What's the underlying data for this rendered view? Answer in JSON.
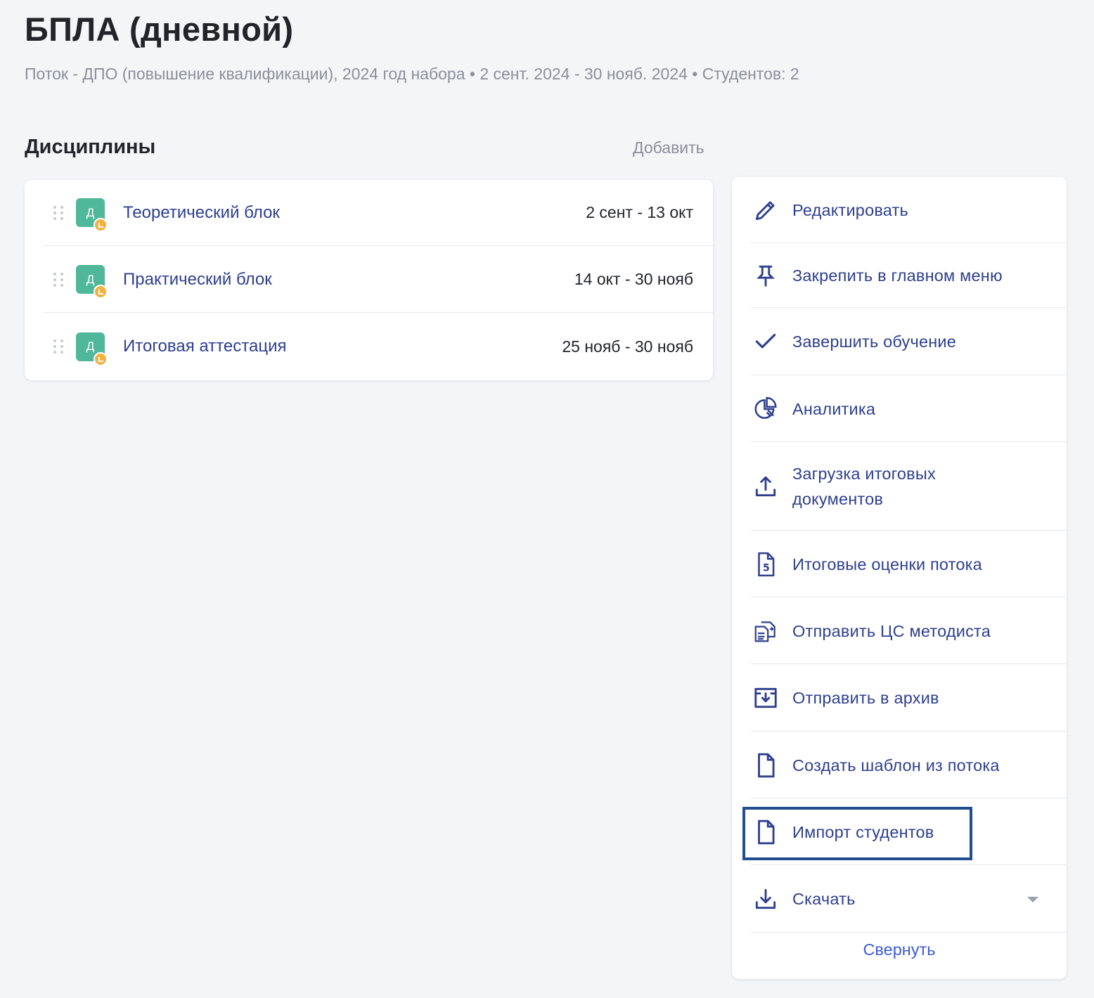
{
  "header": {
    "title": "БПЛА (дневной)",
    "subtitle": "Поток - ДПО (повышение квалификации), 2024 год набора • 2 сент. 2024 - 30 нояб. 2024 • Студентов: 2"
  },
  "disciplines": {
    "title": "Дисциплины",
    "add_label": "Добавить",
    "items": [
      {
        "badge": "Д",
        "name": "Теоретический блок",
        "dates": "2 сент - 13 окт"
      },
      {
        "badge": "Д",
        "name": "Практический блок",
        "dates": "14 окт - 30 нояб"
      },
      {
        "badge": "Д",
        "name": "Итоговая аттестация",
        "dates": "25 нояб - 30 нояб"
      }
    ]
  },
  "actions": {
    "items": [
      {
        "icon": "pencil-icon",
        "label": "Редактировать"
      },
      {
        "icon": "pin-icon",
        "label": "Закрепить в главном меню"
      },
      {
        "icon": "checkmark-icon",
        "label": "Завершить обучение"
      },
      {
        "icon": "pie-chart-icon",
        "label": "Аналитика"
      },
      {
        "icon": "upload-icon",
        "label": "Загрузка итоговых документов"
      },
      {
        "icon": "grade-document-icon",
        "label": "Итоговые оценки потока"
      },
      {
        "icon": "send-documents-icon",
        "label": "Отправить ЦС методиста"
      },
      {
        "icon": "archive-icon",
        "label": "Отправить в архив"
      },
      {
        "icon": "file-icon",
        "label": "Создать шаблон из потока"
      },
      {
        "icon": "file-icon",
        "label": "Импорт студентов"
      },
      {
        "icon": "download-icon",
        "label": "Скачать"
      }
    ],
    "collapse_label": "Свернуть",
    "accent_color": "#2e3f8f",
    "highlight_color": "#1f4f8f"
  }
}
